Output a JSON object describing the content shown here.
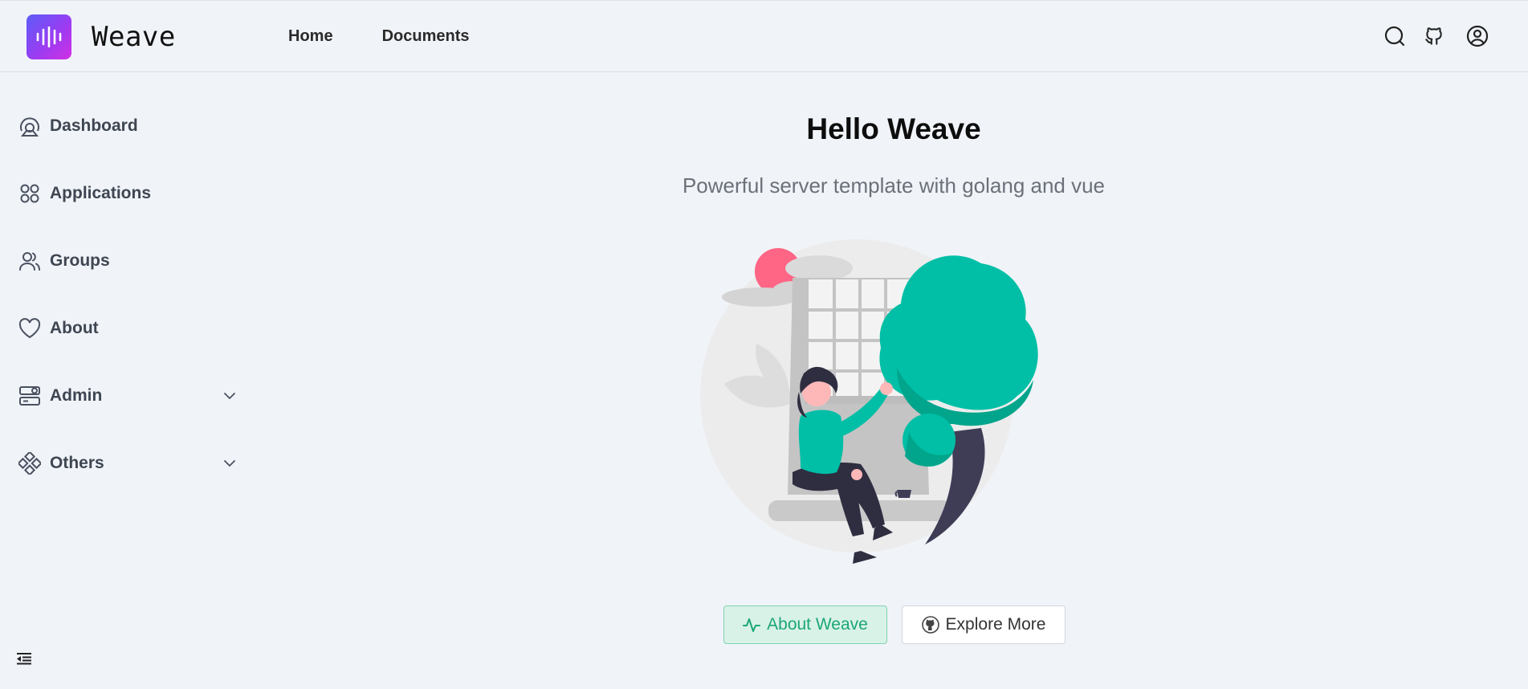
{
  "header": {
    "brand": "Weave",
    "nav": [
      {
        "label": "Home"
      },
      {
        "label": "Documents"
      }
    ],
    "icons": [
      "search-icon",
      "github-icon",
      "user-account-icon"
    ]
  },
  "sidebar": {
    "items": [
      {
        "label": "Dashboard",
        "icon": "dashboard-icon"
      },
      {
        "label": "Applications",
        "icon": "applications-icon"
      },
      {
        "label": "Groups",
        "icon": "groups-icon"
      },
      {
        "label": "About",
        "icon": "heart-icon"
      },
      {
        "label": "Admin",
        "icon": "admin-icon",
        "expandable": true
      },
      {
        "label": "Others",
        "icon": "others-icon",
        "expandable": true
      }
    ],
    "collapse_icon": "menu-collapse-icon"
  },
  "main": {
    "title": "Hello Weave",
    "subtitle": "Powerful server template with golang and vue",
    "buttons": {
      "about": "About Weave",
      "explore": "Explore More"
    }
  },
  "colors": {
    "accent": "#1ca677",
    "background": "#f0f3f8",
    "logo_gradient_start": "#5b5df7",
    "logo_gradient_end": "#d12fe3",
    "tree": "#00bfa6"
  }
}
